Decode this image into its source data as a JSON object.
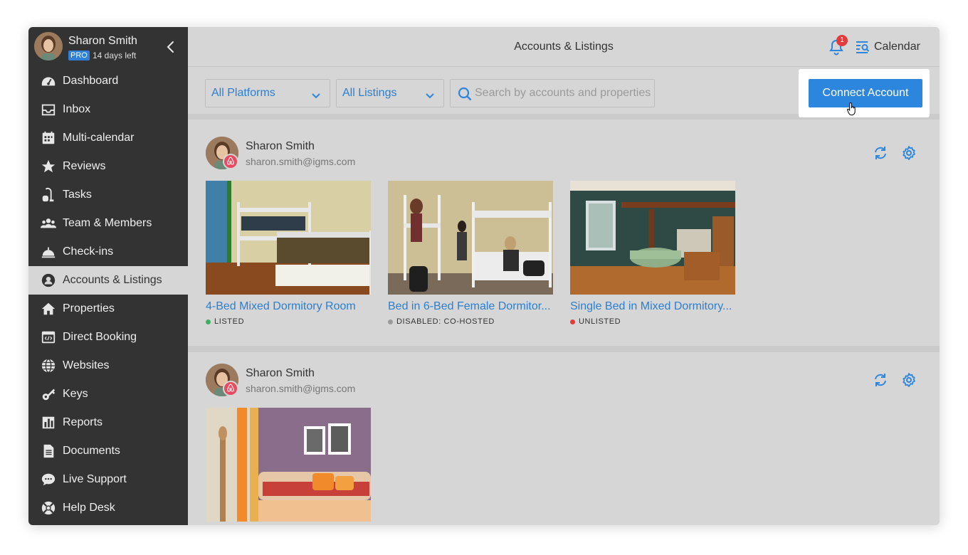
{
  "profile": {
    "name": "Sharon Smith",
    "plan": "PRO",
    "trial": "14 days left"
  },
  "nav": [
    {
      "label": "Dashboard",
      "icon": "dashboard-icon"
    },
    {
      "label": "Inbox",
      "icon": "inbox-icon"
    },
    {
      "label": "Multi-calendar",
      "icon": "calendar-grid-icon"
    },
    {
      "label": "Reviews",
      "icon": "star-icon"
    },
    {
      "label": "Tasks",
      "icon": "vacuum-icon"
    },
    {
      "label": "Team & Members",
      "icon": "team-icon"
    },
    {
      "label": "Check-ins",
      "icon": "service-bell-icon"
    },
    {
      "label": "Accounts & Listings",
      "icon": "user-circle-icon",
      "active": true
    },
    {
      "label": "Properties",
      "icon": "home-icon"
    },
    {
      "label": "Direct Booking",
      "icon": "browser-code-icon"
    },
    {
      "label": "Websites",
      "icon": "globe-icon"
    },
    {
      "label": "Keys",
      "icon": "key-icon"
    },
    {
      "label": "Reports",
      "icon": "bar-chart-icon"
    },
    {
      "label": "Documents",
      "icon": "document-icon"
    },
    {
      "label": "Live Support",
      "icon": "chat-icon"
    },
    {
      "label": "Help Desk",
      "icon": "lifebuoy-icon"
    }
  ],
  "header": {
    "title": "Accounts & Listings",
    "notifications": "1",
    "calendar_label": "Calendar"
  },
  "filters": {
    "platform": "All Platforms",
    "listings": "All Listings",
    "search_placeholder": "Search by accounts and properties",
    "connect_label": "Connect Account"
  },
  "accounts": [
    {
      "name": "Sharon Smith",
      "email": "sharon.smith@igms.com",
      "listings": [
        {
          "title": "4-Bed Mixed Dormitory Room",
          "status": "LISTED",
          "status_color": "#3cb15c"
        },
        {
          "title": "Bed in 6-Bed Female Dormitor...",
          "status": "DISABLED: CO-HOSTED",
          "status_color": "#9a9a9a"
        },
        {
          "title": "Single Bed in Mixed Dormitory...",
          "status": "UNLISTED",
          "status_color": "#e23b3b"
        }
      ]
    },
    {
      "name": "Sharon Smith",
      "email": "sharon.smith@igms.com",
      "listings": [
        {
          "title": "",
          "status": "",
          "status_color": ""
        }
      ]
    }
  ],
  "colors": {
    "accent": "#2d86de",
    "sidebar": "#333333",
    "content_bg": "#d6d6d6"
  }
}
